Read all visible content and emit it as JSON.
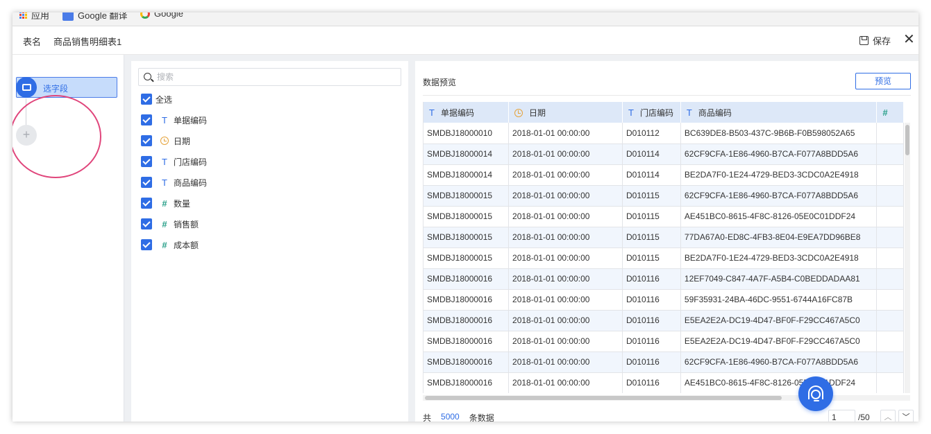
{
  "bookmarks": [
    {
      "label": "应用",
      "icon": "apps-grid-icon"
    },
    {
      "label": "Google 翻译",
      "icon": "google-translate-icon"
    },
    {
      "label": "Google",
      "icon": "google-icon"
    }
  ],
  "header": {
    "name_label": "表名",
    "table_name": "商品销售明细表1",
    "save_label": "保存",
    "close_icon": "close-icon"
  },
  "steps": {
    "active_label": "选字段",
    "add_symbol": "+"
  },
  "fields": {
    "search_placeholder": "搜索",
    "select_all": "全选",
    "items": [
      {
        "name": "单据编码",
        "type": "text",
        "type_icon": "T",
        "checked": true
      },
      {
        "name": "日期",
        "type": "date",
        "type_icon": "",
        "checked": true
      },
      {
        "name": "门店编码",
        "type": "text",
        "type_icon": "T",
        "checked": true
      },
      {
        "name": "商品编码",
        "type": "text",
        "type_icon": "T",
        "checked": true
      },
      {
        "name": "数量",
        "type": "number",
        "type_icon": "#",
        "checked": true
      },
      {
        "name": "销售额",
        "type": "number",
        "type_icon": "#",
        "checked": true
      },
      {
        "name": "成本额",
        "type": "number",
        "type_icon": "#",
        "checked": true
      }
    ]
  },
  "preview": {
    "title": "数据预览",
    "button": "预览",
    "columns": [
      {
        "name": "单据编码",
        "icon": "T"
      },
      {
        "name": "日期",
        "icon": ""
      },
      {
        "name": "门店编码",
        "icon": "T"
      },
      {
        "name": "商品编码",
        "icon": "T"
      },
      {
        "name": "",
        "icon": "#"
      }
    ],
    "rows": [
      [
        "SMDBJ18000010",
        "2018-01-01 00:00:00",
        "D010112",
        "BC639DE8-B503-437C-9B6B-F0B598052A65"
      ],
      [
        "SMDBJ18000014",
        "2018-01-01 00:00:00",
        "D010114",
        "62CF9CFA-1E86-4960-B7CA-F077A8BDD5A6"
      ],
      [
        "SMDBJ18000014",
        "2018-01-01 00:00:00",
        "D010114",
        "BE2DA7F0-1E24-4729-BED3-3CDC0A2E4918"
      ],
      [
        "SMDBJ18000015",
        "2018-01-01 00:00:00",
        "D010115",
        "62CF9CFA-1E86-4960-B7CA-F077A8BDD5A6"
      ],
      [
        "SMDBJ18000015",
        "2018-01-01 00:00:00",
        "D010115",
        "AE451BC0-8615-4F8C-8126-05E0C01DDF24"
      ],
      [
        "SMDBJ18000015",
        "2018-01-01 00:00:00",
        "D010115",
        "77DA67A0-ED8C-4FB3-8E04-E9EA7DD96BE8"
      ],
      [
        "SMDBJ18000015",
        "2018-01-01 00:00:00",
        "D010115",
        "BE2DA7F0-1E24-4729-BED3-3CDC0A2E4918"
      ],
      [
        "SMDBJ18000016",
        "2018-01-01 00:00:00",
        "D010116",
        "12EF7049-C847-4A7F-A5B4-C0BEDDADAA81"
      ],
      [
        "SMDBJ18000016",
        "2018-01-01 00:00:00",
        "D010116",
        "59F35931-24BA-46DC-9551-6744A16FC87B"
      ],
      [
        "SMDBJ18000016",
        "2018-01-01 00:00:00",
        "D010116",
        "E5EA2E2A-DC19-4D47-BF0F-F29CC467A5C0"
      ],
      [
        "SMDBJ18000016",
        "2018-01-01 00:00:00",
        "D010116",
        "E5EA2E2A-DC19-4D47-BF0F-F29CC467A5C0"
      ],
      [
        "SMDBJ18000016",
        "2018-01-01 00:00:00",
        "D010116",
        "62CF9CFA-1E86-4960-B7CA-F077A8BDD5A6"
      ],
      [
        "SMDBJ18000016",
        "2018-01-01 00:00:00",
        "D010116",
        "AE451BC0-8615-4F8C-8126-05E0C01DDF24"
      ]
    ],
    "footer": {
      "prefix": "共",
      "count": "5000",
      "suffix": "条数据",
      "page": "1",
      "total_pages": "/50"
    }
  },
  "colors": {
    "primary": "#2f6de5",
    "highlight_ring": "#e0457b",
    "number_type": "#2aa08a",
    "date_type": "#e5a33b"
  }
}
